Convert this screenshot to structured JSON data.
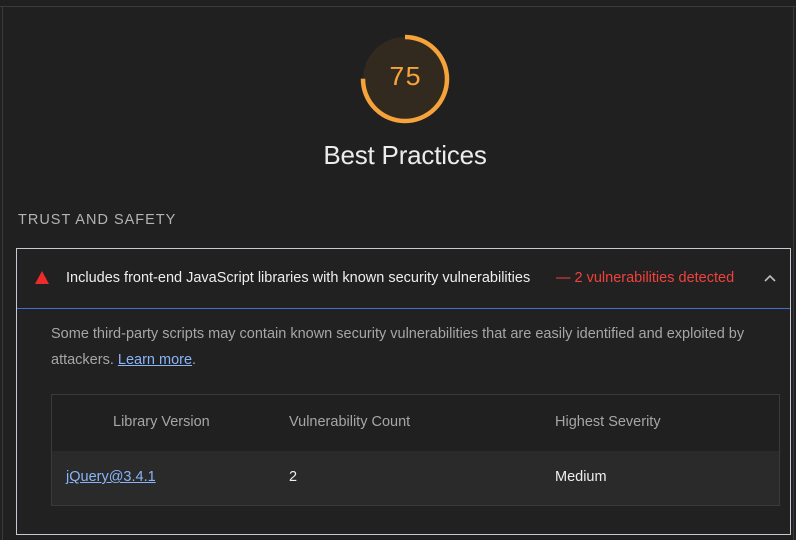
{
  "category": {
    "score": "75",
    "score_fraction": 0.75,
    "title": "Best Practices",
    "accent_color": "#f5a33a"
  },
  "group": {
    "title": "TRUST AND SAFETY"
  },
  "audit": {
    "title": "Includes front-end JavaScript libraries with known security vulnerabilities",
    "display_value": "— 2 vulnerabilities detected",
    "status_color": "#ec2b2b",
    "status_icon": "fail-triangle-icon",
    "expanded": true,
    "description": "Some third-party scripts may contain known security vulnerabilities that are easily identified and exploited by attackers.",
    "learn_more": "Learn more",
    "description_end": "."
  },
  "table": {
    "headers": [
      "Library Version",
      "Vulnerability Count",
      "Highest Severity"
    ],
    "rows": [
      {
        "library": "jQuery@3.4.1",
        "count": "2",
        "severity": "Medium"
      }
    ]
  }
}
